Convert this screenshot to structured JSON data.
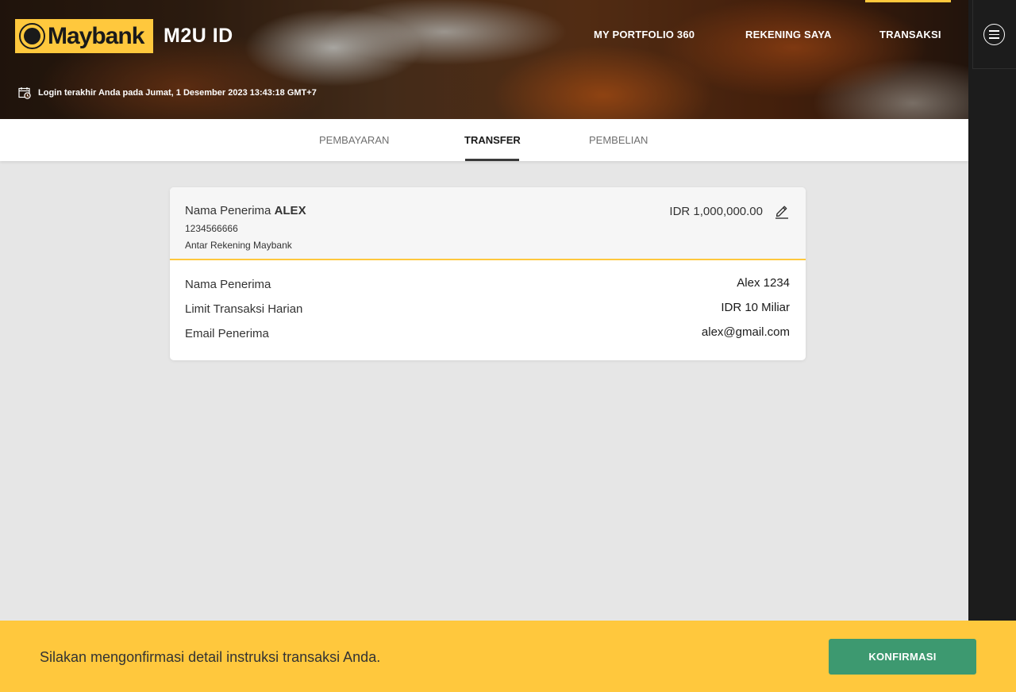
{
  "header": {
    "brand": "Maybank",
    "product": "M2U ID",
    "nav": [
      {
        "label": "MY PORTFOLIO 360"
      },
      {
        "label": "REKENING SAYA"
      },
      {
        "label": "TRANSAKSI"
      }
    ],
    "login_info": "Login terakhir Anda pada Jumat, 1 Desember 2023 13:43:18 GMT+7"
  },
  "tabs": [
    {
      "label": "PEMBAYARAN"
    },
    {
      "label": "TRANSFER"
    },
    {
      "label": "PEMBELIAN"
    }
  ],
  "card": {
    "title_prefix": "Nama Penerima",
    "recipient_name": "ALEX",
    "account_number": "1234566666",
    "transfer_type": "Antar Rekening Maybank",
    "amount": "IDR 1,000,000.00",
    "rows": [
      {
        "label": "Nama Penerima",
        "value": "Alex 1234"
      },
      {
        "label": "Limit Transaksi Harian",
        "value": "IDR 10 Miliar"
      },
      {
        "label": "Email Penerima",
        "value": "alex@gmail.com"
      }
    ]
  },
  "footer": {
    "message": "Silakan mengonfirmasi detail instruksi transaksi Anda.",
    "confirm_label": "KONFIRMASI"
  },
  "colors": {
    "accent": "#ffc83d",
    "confirm": "#3d9970",
    "sidebar": "#1c1c1c"
  }
}
